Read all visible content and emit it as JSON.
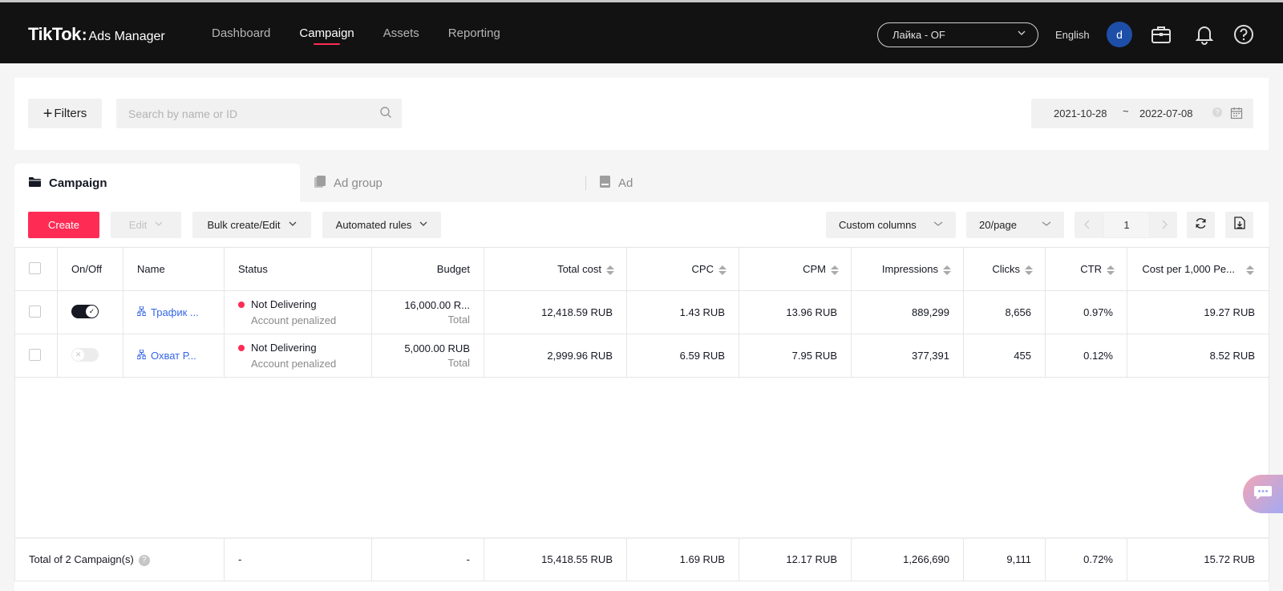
{
  "app": {
    "logo_main": "TikTok",
    "logo_colon": ":",
    "logo_sub": "Ads Manager"
  },
  "nav": [
    {
      "label": "Dashboard"
    },
    {
      "label": "Campaign"
    },
    {
      "label": "Assets"
    },
    {
      "label": "Reporting"
    }
  ],
  "account_selector": "Лайка - OF",
  "language": "English",
  "avatar_letter": "d",
  "filters": {
    "filters_label": "Filters",
    "search_placeholder": "Search by name or ID",
    "date_start": "2021-10-28",
    "date_sep": "~",
    "date_end": "2022-07-08"
  },
  "tabs": [
    {
      "label": "Campaign"
    },
    {
      "label": "Ad group"
    },
    {
      "label": "Ad"
    }
  ],
  "toolbar": {
    "create": "Create",
    "edit": "Edit",
    "bulk": "Bulk create/Edit",
    "automated": "Automated rules",
    "custom_columns": "Custom columns",
    "per_page": "20/page",
    "page": "1"
  },
  "table": {
    "headers": [
      "On/Off",
      "Name",
      "Status",
      "Budget",
      "Total cost",
      "CPC",
      "CPM",
      "Impressions",
      "Clicks",
      "CTR",
      "Cost per 1,000 Pe..."
    ],
    "rows": [
      {
        "on": true,
        "name": "Трафик ...",
        "status": "Not Delivering",
        "status_sub": "Account penalized",
        "budget": "16,000.00 R...",
        "budget_sub": "Total",
        "total_cost": "12,418.59 RUB",
        "cpc": "1.43 RUB",
        "cpm": "13.96 RUB",
        "impressions": "889,299",
        "clicks": "8,656",
        "ctr": "0.97%",
        "cost_per_1000": "19.27 RUB"
      },
      {
        "on": false,
        "name": "Охват Р...",
        "status": "Not Delivering",
        "status_sub": "Account penalized",
        "budget": "5,000.00 RUB",
        "budget_sub": "Total",
        "total_cost": "2,999.96 RUB",
        "cpc": "6.59 RUB",
        "cpm": "7.95 RUB",
        "impressions": "377,391",
        "clicks": "455",
        "ctr": "0.12%",
        "cost_per_1000": "8.52 RUB"
      }
    ],
    "totals": {
      "label": "Total of 2 Campaign(s)",
      "status": "-",
      "budget": "-",
      "total_cost": "15,418.55 RUB",
      "cpc": "1.69 RUB",
      "cpm": "12.17 RUB",
      "impressions": "1,266,690",
      "clicks": "9,111",
      "ctr": "0.72%",
      "cost_per_1000": "15.72 RUB"
    }
  },
  "colors": {
    "accent": "#fe2c55",
    "topbar": "#121212",
    "link": "#3466e6"
  }
}
